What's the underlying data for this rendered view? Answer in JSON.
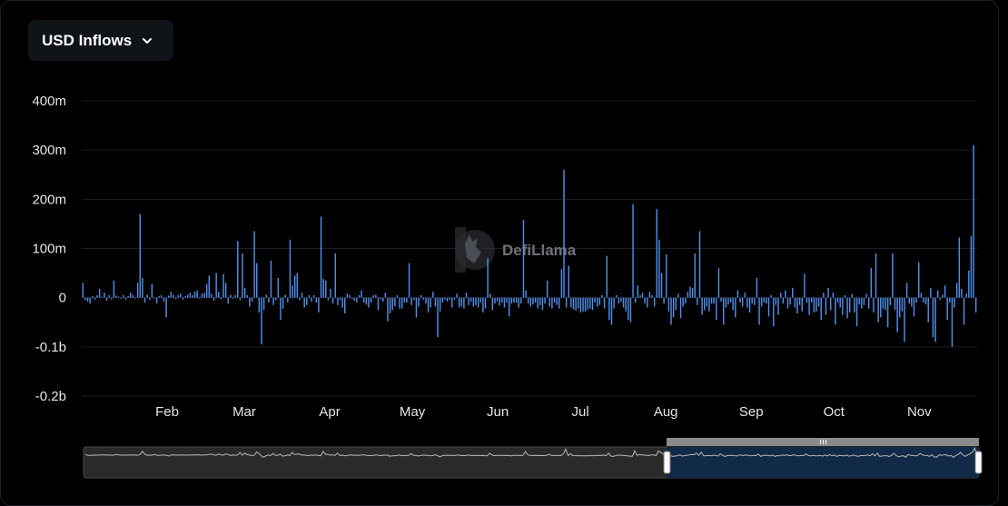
{
  "header": {
    "metric_label": "USD Inflows"
  },
  "watermark": "DefiLlama",
  "colors": {
    "bar": "#4f8fea",
    "grid": "#1a1d22",
    "slider_selection": "#102a47",
    "slider_track": "#2a2a2a"
  },
  "chart_data": {
    "type": "bar",
    "ylabel": "",
    "xlabel": "",
    "y_tick_labels": [
      "400m",
      "300m",
      "200m",
      "100m",
      "0",
      "-0.1b",
      "-0.2b"
    ],
    "y_tick_values": [
      400,
      300,
      200,
      100,
      0,
      -100,
      -200
    ],
    "ylim": [
      -200,
      400
    ],
    "y_unit": "millions USD",
    "x_tick_labels": [
      "Feb",
      "Mar",
      "Apr",
      "May",
      "Jun",
      "Jul",
      "Aug",
      "Sep",
      "Oct",
      "Nov"
    ],
    "x_tick_days": [
      31,
      59,
      90,
      120,
      151,
      181,
      212,
      243,
      273,
      304
    ],
    "days_shown": 325,
    "grid": true,
    "series": [
      {
        "values": [
          30,
          -5,
          -8,
          -12,
          3,
          -4,
          5,
          18,
          2,
          10,
          -6,
          5,
          -3,
          35,
          4,
          2,
          -2,
          5,
          -4,
          3,
          10,
          5,
          -2,
          30,
          170,
          40,
          -10,
          6,
          -4,
          28,
          -2,
          -12,
          3,
          5,
          -8,
          -40,
          4,
          12,
          6,
          -3,
          5,
          8,
          -4,
          3,
          6,
          10,
          5,
          12,
          15,
          -2,
          8,
          10,
          28,
          45,
          8,
          -6,
          50,
          12,
          -3,
          48,
          30,
          -12,
          6,
          -2,
          5,
          115,
          -5,
          90,
          20,
          5,
          -18,
          -8,
          135,
          70,
          -30,
          -95,
          -25,
          6,
          -10,
          75,
          -15,
          -5,
          40,
          -45,
          -22,
          6,
          -10,
          118,
          25,
          45,
          50,
          -5,
          10,
          -20,
          -15,
          5,
          -8,
          5,
          -10,
          -30,
          165,
          38,
          35,
          -5,
          18,
          -12,
          90,
          -15,
          -5,
          -20,
          -32,
          8,
          5,
          -2,
          -6,
          -10,
          5,
          15,
          -10,
          -14,
          -20,
          -10,
          5,
          6,
          -25,
          -3,
          -8,
          10,
          -48,
          -32,
          -25,
          -18,
          5,
          -22,
          -22,
          -10,
          -10,
          70,
          -15,
          -5,
          -40,
          -18,
          5,
          -4,
          -12,
          -30,
          -20,
          12,
          -18,
          -80,
          -28,
          -10,
          -4,
          -8,
          -4,
          -20,
          -5,
          8,
          -20,
          -18,
          -22,
          10,
          -15,
          -8,
          -18,
          -15,
          -20,
          -10,
          -30,
          -22,
          80,
          8,
          -25,
          -12,
          -8,
          -16,
          -10,
          -20,
          -10,
          -38,
          -12,
          -10,
          -10,
          -20,
          -12,
          158,
          15,
          -12,
          -18,
          -14,
          -10,
          -22,
          -15,
          -25,
          -12,
          35,
          -18,
          -22,
          -10,
          -15,
          -22,
          58,
          260,
          -20,
          65,
          -20,
          -24,
          -26,
          -22,
          -30,
          -28,
          -28,
          -24,
          -22,
          -25,
          -10,
          -18,
          -15,
          5,
          -22,
          85,
          -45,
          -55,
          -22,
          5,
          -12,
          -8,
          -20,
          -28,
          -45,
          -50,
          190,
          -10,
          25,
          5,
          10,
          -12,
          -20,
          12,
          5,
          -18,
          180,
          118,
          50,
          -12,
          88,
          -28,
          -55,
          -40,
          -25,
          8,
          -42,
          -18,
          -12,
          12,
          22,
          20,
          90,
          -15,
          135,
          -35,
          -25,
          -18,
          -28,
          -12,
          -12,
          -45,
          60,
          -8,
          -55,
          -20,
          -14,
          -10,
          -25,
          -40,
          15,
          -10,
          -18,
          10,
          -20,
          -30,
          -12,
          -15,
          40,
          -55,
          -18,
          -10,
          -12,
          -38,
          5,
          -58,
          -15,
          -35,
          10,
          -12,
          15,
          -22,
          -14,
          20,
          -20,
          -32,
          -15,
          -28,
          48,
          -10,
          -35,
          -10,
          -30,
          -28,
          -18,
          -45,
          10,
          -35,
          20,
          -25,
          10,
          -55,
          -10,
          -20,
          -35,
          5,
          -42,
          -30,
          8,
          -30,
          -58,
          -14,
          -22,
          -15,
          8,
          -22,
          60,
          -30,
          90,
          -50,
          -40,
          -22,
          -25,
          -60,
          -15,
          90,
          -25,
          -70,
          -40,
          -28,
          -90,
          30,
          -12,
          -18,
          -38,
          -10,
          72,
          10,
          -10,
          -14,
          -50,
          20,
          -80,
          -90,
          15,
          -4,
          6,
          25,
          -45,
          -10,
          -100,
          -20,
          30,
          122,
          18,
          -55,
          8,
          55,
          125,
          310,
          -30
        ]
      }
    ]
  }
}
